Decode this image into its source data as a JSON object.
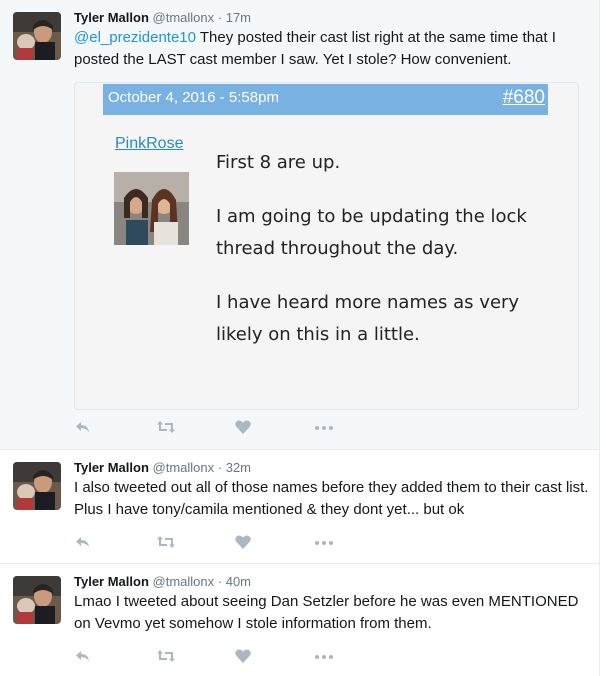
{
  "tweets": [
    {
      "name": "Tyler Mallon",
      "handle": "@tmallonx",
      "dot": "·",
      "time": "17m",
      "mention": "@el_prezidente10",
      "text": " They posted their cast list right at the same time that I posted the LAST cast member I saw. Yet I stole? How convenient.",
      "quote": {
        "date": "October 4, 2016 - 5:58pm",
        "post_number": "#680",
        "user": "PinkRose",
        "paragraphs": [
          "First 8 are up.",
          "I am going to be updating the lock thread throughout the day.",
          "I have heard more names as very likely on this in a little."
        ]
      }
    },
    {
      "name": "Tyler Mallon",
      "handle": "@tmallonx",
      "dot": "·",
      "time": "32m",
      "text": "I also tweeted out all of those names before they added them to their cast list. Plus I have tony/camila mentioned & they dont yet... but ok"
    },
    {
      "name": "Tyler Mallon",
      "handle": "@tmallonx",
      "dot": "·",
      "time": "40m",
      "text": "Lmao I tweeted about seeing Dan Setzler before he was even MENTIONED on Vevmo yet somehow I stole information from them."
    }
  ],
  "icons": {
    "reply": "reply-icon",
    "retweet": "retweet-icon",
    "like": "heart-icon",
    "more": "more-icon"
  },
  "colors": {
    "link": "#1b95e0",
    "quote_bar": "#7ab1e3",
    "quote_user": "#2a8bb8",
    "action_icon": "#aab8c2"
  }
}
